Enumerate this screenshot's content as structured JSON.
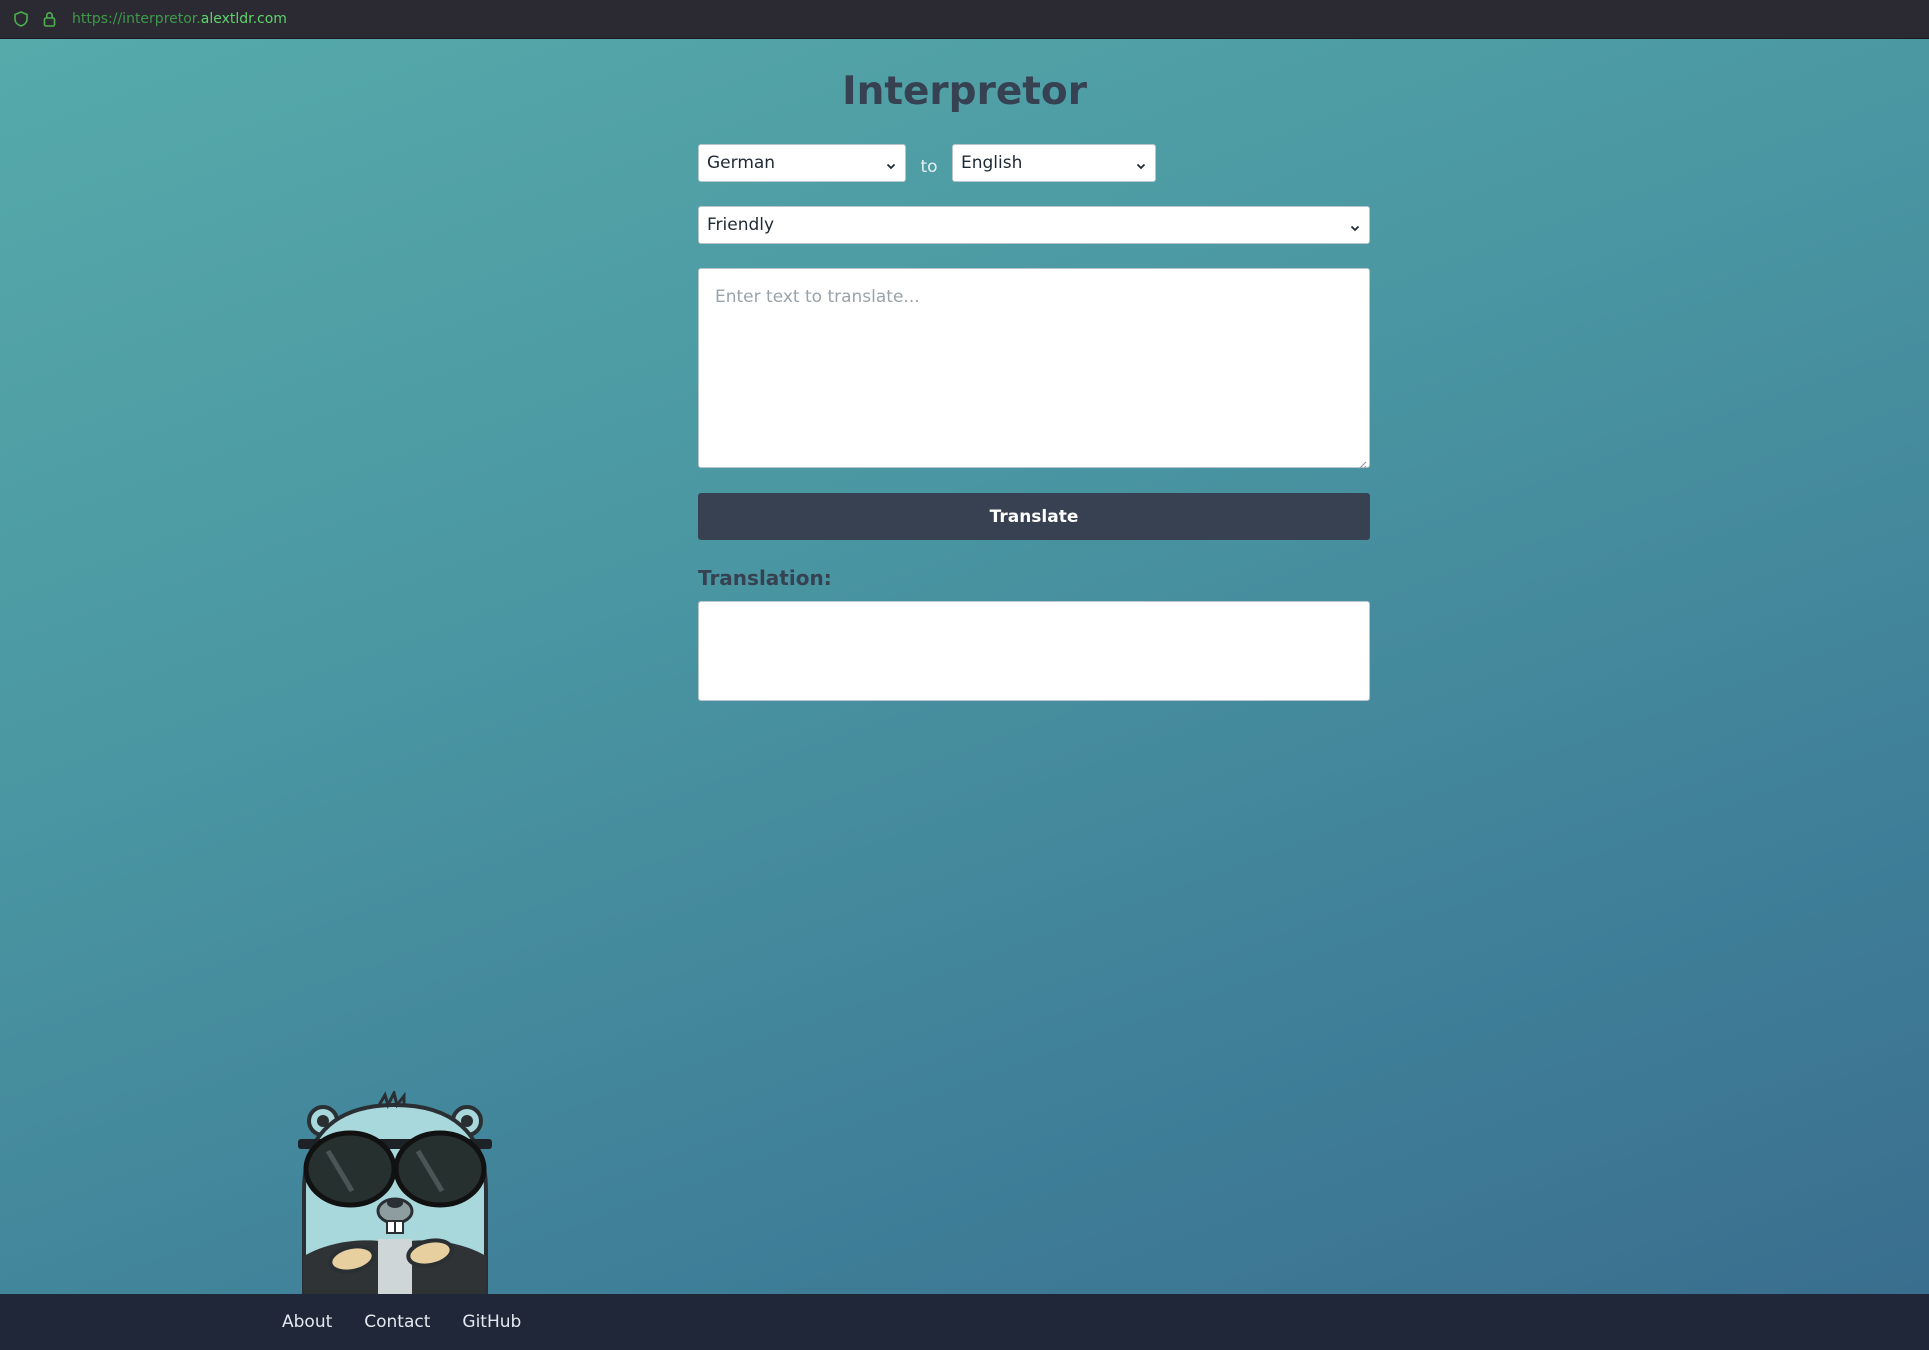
{
  "browser": {
    "url_prefix": "https://interpretor.",
    "url_domain": "alextldr.com",
    "icons": [
      "shield-icon",
      "lock-icon"
    ]
  },
  "app": {
    "title": "Interpretor",
    "source_language": "German",
    "connector": "to",
    "target_language": "English",
    "tone": "Friendly",
    "input_placeholder": "Enter text to translate...",
    "translate_label": "Translate",
    "translation_label": "Translation:",
    "translation_output": ""
  },
  "footer": {
    "links": [
      "About",
      "Contact",
      "GitHub"
    ]
  },
  "colors": {
    "accent_dark": "#374151",
    "footer_bg": "#1f2738",
    "url_green": "#5fd36b"
  }
}
